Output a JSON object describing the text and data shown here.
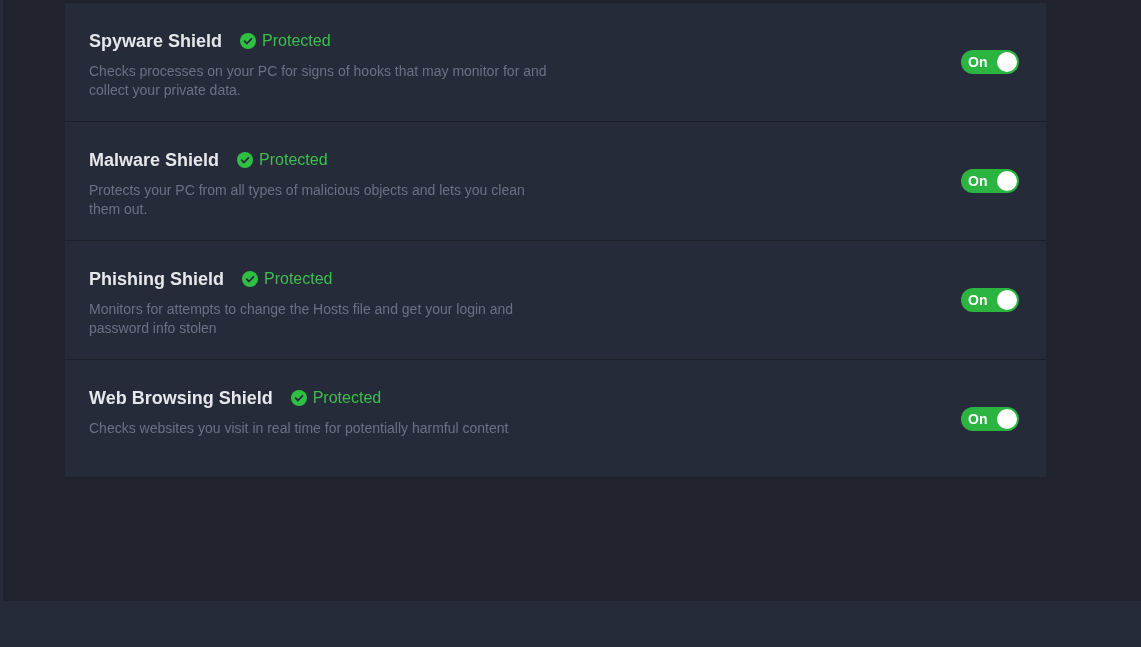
{
  "shields": [
    {
      "name": "Spyware Shield",
      "status": "Protected",
      "description": "Checks processes on your PC for signs of hooks that may monitor for and collect your private data.",
      "toggle": {
        "label": "On",
        "on": true
      }
    },
    {
      "name": "Malware Shield",
      "status": "Protected",
      "description": "Protects your PC from all types of malicious objects and lets you clean them out.",
      "toggle": {
        "label": "On",
        "on": true
      }
    },
    {
      "name": "Phishing Shield",
      "status": "Protected",
      "description": "Monitors for attempts to change the Hosts file and get your login and password info stolen",
      "toggle": {
        "label": "On",
        "on": true
      }
    },
    {
      "name": "Web Browsing Shield",
      "status": "Protected",
      "description": "Checks websites you visit in real time for potentially harmful content",
      "toggle": {
        "label": "On",
        "on": true
      }
    }
  ]
}
